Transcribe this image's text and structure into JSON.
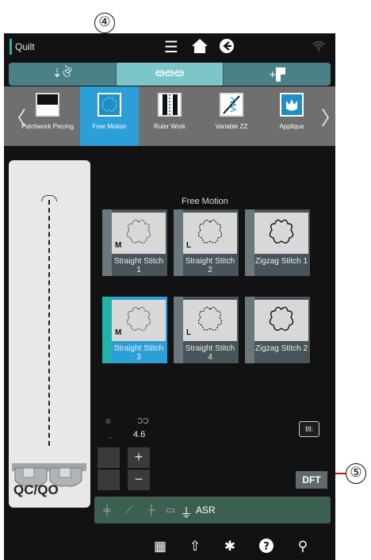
{
  "callouts": {
    "four": "④",
    "five": "⑤"
  },
  "status_bar": {
    "mode_label": "Quilt",
    "menu_icon": "hamburger-menu-icon",
    "home_icon": "home-icon",
    "exit_icon": "exit-icon",
    "wifi_icon": "wifi-icon"
  },
  "category_tabs": [
    {
      "name": "utility-stitch-tab",
      "glyph": "⇣ঔ"
    },
    {
      "name": "decorative-stitch-tab",
      "glyph": "ఴఴఴ"
    },
    {
      "name": "add-foot-tab",
      "glyph": "+▛"
    }
  ],
  "stitch_types": [
    {
      "label": "Patchwork Piecing",
      "name": "patchwork-piecing"
    },
    {
      "label": "Free Motion",
      "name": "free-motion",
      "selected": true
    },
    {
      "label": "Ruler Work",
      "name": "ruler-work"
    },
    {
      "label": "Variable ZZ",
      "name": "variable-zz"
    },
    {
      "label": "Applique",
      "name": "applique"
    }
  ],
  "foot_panel": {
    "label": "QC/QO"
  },
  "grid": {
    "title": "Free Motion",
    "stitches": [
      {
        "size": "M",
        "name": "Straight Stitch 1"
      },
      {
        "size": "L",
        "name": "Straight Stitch 2"
      },
      {
        "size": "",
        "name": "Zigzag Stitch 1"
      },
      {
        "size": "M",
        "name": "Straight Stitch 3",
        "selected": true
      },
      {
        "size": "L",
        "name": "Straight Stitch 4"
      },
      {
        "size": "",
        "name": "Zigzag Stitch 2"
      }
    ]
  },
  "controls": {
    "density_glyph": "≡",
    "dash_glyph": "-",
    "stitch_glyph": "ƆƆ",
    "stitch_value": "4.6",
    "plus": "+",
    "minus": "−",
    "feed_label": "III:",
    "dft_label": "DFT"
  },
  "function_bar": {
    "asr_label": "ASR"
  },
  "accent_colors": {
    "teal": "#1fb8b0",
    "blue": "#2d9fd8",
    "callout_red": "#e01010"
  },
  "bottom_nav": [
    "sewing-app-icon",
    "export-icon",
    "settings-icon",
    "help-icon",
    "wrench-icon"
  ]
}
